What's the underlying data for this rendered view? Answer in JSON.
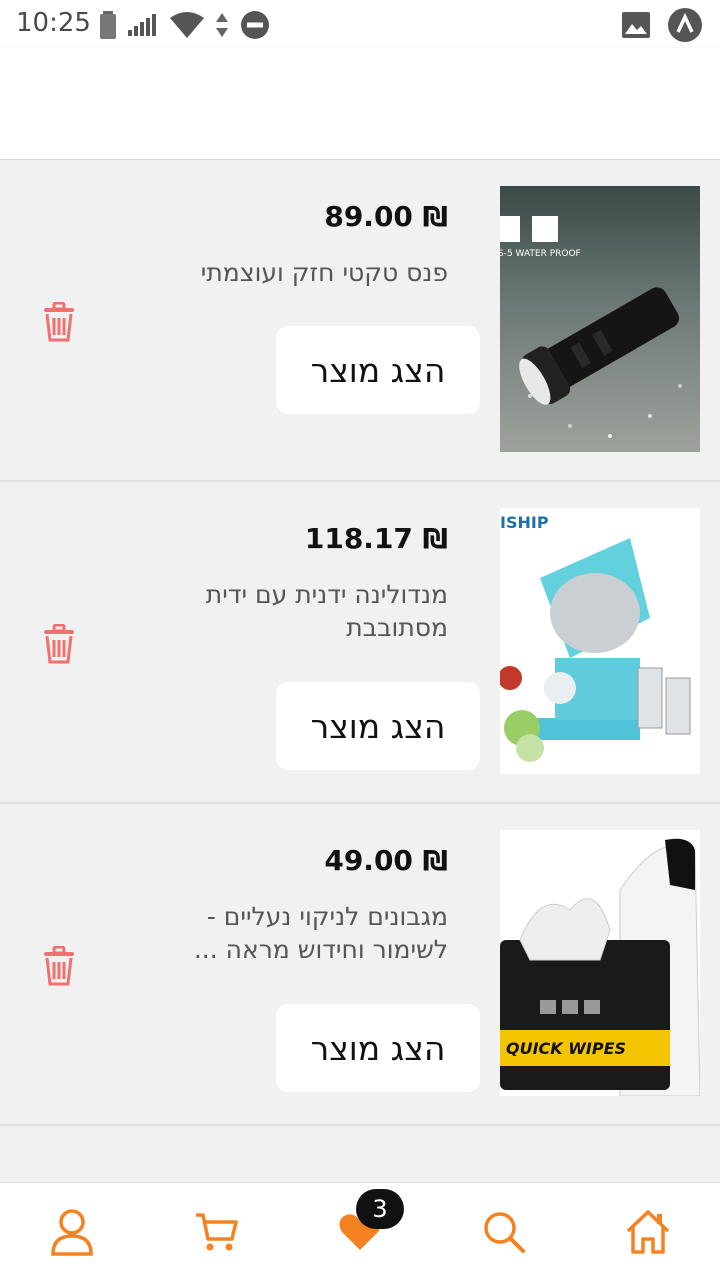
{
  "status_bar": {
    "time": "10:25"
  },
  "colors": {
    "accent": "#f58220",
    "trash": "#f07070",
    "background": "#f1f1f1"
  },
  "wishlist": {
    "items": [
      {
        "price": "₪ 89.00",
        "name": "פנס טקטי חזק ועוצמתי",
        "button_label": "הצג מוצר",
        "image_text": "S-5 WATER PROOF"
      },
      {
        "price": "₪ 118.17",
        "name": "מנדולינה ידנית עם ידית מסתובבת",
        "button_label": "הצג מוצר",
        "image_text": "ISHIP"
      },
      {
        "price": "₪ 49.00",
        "name": "מגבונים לניקוי נעליים - לשימור וחידוש מראה ...",
        "button_label": "הצג מוצר",
        "image_text": "QUICK WIPES"
      }
    ]
  },
  "bottom_nav": {
    "favorites_badge": "3",
    "icons": [
      "user-icon",
      "cart-icon",
      "heart-icon",
      "search-icon",
      "home-icon"
    ]
  }
}
